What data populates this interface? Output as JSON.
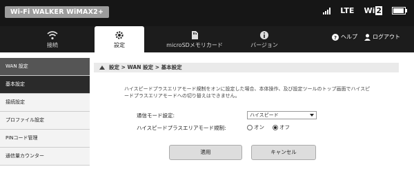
{
  "brand": "Wi-Fi WALKER WiMAX2+",
  "status": {
    "network": "LTE",
    "wifi": "Wi",
    "wifi_sub": "2"
  },
  "tabs": [
    {
      "label": "接続",
      "icon": "wifi-icon"
    },
    {
      "label": "設定",
      "icon": "gear-icon"
    },
    {
      "label": "microSDメモリカード",
      "icon": "sd-card-icon"
    },
    {
      "label": "バージョン",
      "icon": "info-icon"
    }
  ],
  "help": {
    "help_label": "ヘルプ",
    "logout_label": "ログアウト"
  },
  "sidebar": [
    {
      "label": "WAN 設定"
    },
    {
      "label": "基本設定"
    },
    {
      "label": "接続設定"
    },
    {
      "label": "プロファイル設定"
    },
    {
      "label": "PINコード管理"
    },
    {
      "label": "通信量カウンター"
    }
  ],
  "breadcrumb": "設定 > WAN 設定 > 基本設定",
  "description": "ハイスピードプラスエリアモード規制をオンに設定した場合、本体操作、及び設定ツールのトップ画面でハイスピードプラスエリアモードへの切り替えはできません。",
  "form": {
    "mode_label": "通信モード設定:",
    "mode_value": "ハイスピード",
    "restrict_label": "ハイスピードプラスエリアモード規制:",
    "opt_on": "オン",
    "opt_off": "オフ",
    "selected": "オフ"
  },
  "buttons": {
    "apply": "適用",
    "cancel": "キャンセル"
  }
}
